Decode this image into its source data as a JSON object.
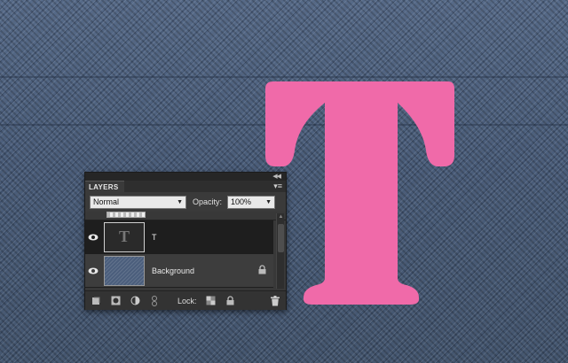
{
  "canvas": {
    "glyph": "T",
    "glyph_color": "#f06aa9",
    "background": "denim-texture"
  },
  "layers_panel": {
    "tab_label": "LAYERS",
    "collapse_icon": "double-chevron-icon",
    "menu_icon": "panel-menu-icon",
    "blend_mode": "Normal",
    "opacity_label": "Opacity:",
    "opacity_value": "100%",
    "layers": [
      {
        "name": "T",
        "type": "text",
        "thumb_text": "T",
        "selected": true,
        "visible": true,
        "locked": false
      },
      {
        "name": "Background",
        "type": "image",
        "selected": false,
        "visible": true,
        "locked": true
      }
    ],
    "footer": {
      "lock_label": "Lock:",
      "buttons": [
        "new-layer-icon",
        "mask-icon",
        "adjustment-layer-icon",
        "link-icon",
        "lock-transparency-icon",
        "lock-all-icon",
        "trash-icon"
      ]
    }
  }
}
